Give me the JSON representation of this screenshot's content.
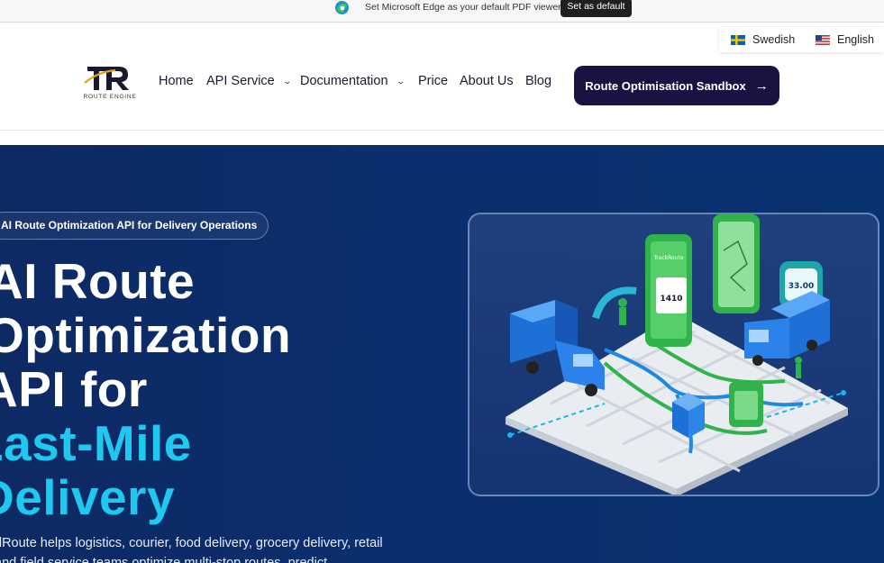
{
  "edge_bar": {
    "message": "Set Microsoft Edge as your default PDF viewer",
    "button_label": "Set as default"
  },
  "languages": [
    {
      "label": "Swedish",
      "flag": "sweden-flag"
    },
    {
      "label": "English",
      "flag": "us-flag"
    }
  ],
  "logo": {
    "letters": "TR",
    "subtitle": "ROUTE ENGINE"
  },
  "nav": {
    "home": "Home",
    "api_service": "API Service",
    "documentation": "Documentation",
    "price": "Price",
    "about": "About Us",
    "blog": "Blog"
  },
  "cta": {
    "label": "Route Optimisation Sandbox"
  },
  "hero": {
    "badge": "AI Route Optimization API for Delivery Operations",
    "headline_lines": [
      "AI Route",
      "Optimization",
      "API for",
      "Last-Mile",
      "Delivery"
    ],
    "lead": "dRoute helps logistics, courier, food delivery, grocery delivery, retail",
    "lead_2": "and field service teams optimize multi-stop routes, predict"
  },
  "illustration": {
    "phone_brand": "TrackRoute",
    "card_value": "1410",
    "price_tag": "33.00"
  },
  "colors": {
    "hero_bg": "#0b2e6e",
    "cta_bg": "#1a1342",
    "accent_cyan": "#1ec8f0",
    "route_green": "#2fb34a",
    "route_blue": "#1e88e5"
  }
}
